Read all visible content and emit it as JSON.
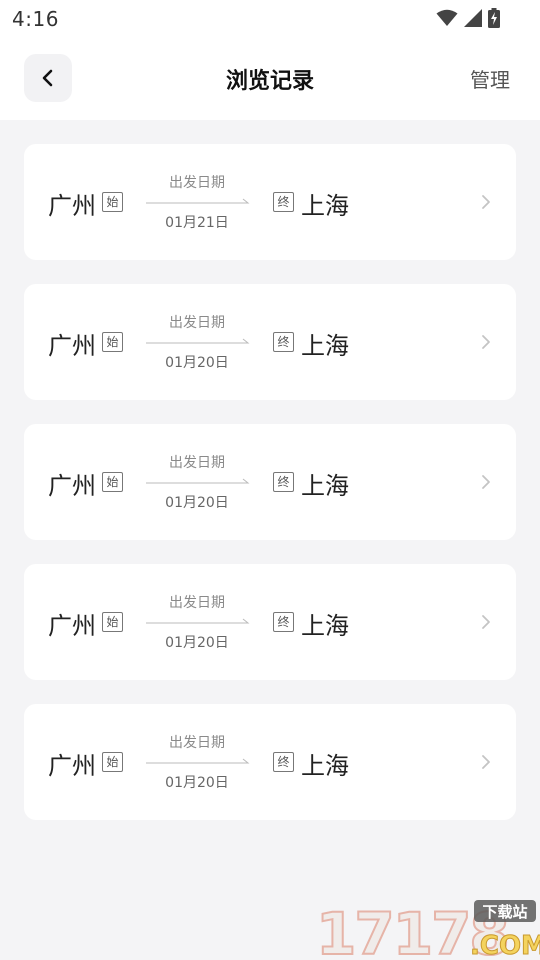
{
  "status_bar": {
    "time": "4:16"
  },
  "header": {
    "title": "浏览记录",
    "manage_label": "管理"
  },
  "records": [
    {
      "origin": "广州",
      "start_tag": "始",
      "depart_label": "出发日期",
      "date": "01月21日",
      "end_tag": "终",
      "destination": "上海"
    },
    {
      "origin": "广州",
      "start_tag": "始",
      "depart_label": "出发日期",
      "date": "01月20日",
      "end_tag": "终",
      "destination": "上海"
    },
    {
      "origin": "广州",
      "start_tag": "始",
      "depart_label": "出发日期",
      "date": "01月20日",
      "end_tag": "终",
      "destination": "上海"
    },
    {
      "origin": "广州",
      "start_tag": "始",
      "depart_label": "出发日期",
      "date": "01月20日",
      "end_tag": "终",
      "destination": "上海"
    },
    {
      "origin": "广州",
      "start_tag": "始",
      "depart_label": "出发日期",
      "date": "01月20日",
      "end_tag": "终",
      "destination": "上海"
    }
  ],
  "watermark": {
    "number": "17178",
    "badge": "下载站",
    "suffix": ".COM"
  },
  "colors": {
    "background": "#f4f4f6",
    "card": "#ffffff",
    "text": "#222222",
    "muted": "#8a8a8a"
  }
}
